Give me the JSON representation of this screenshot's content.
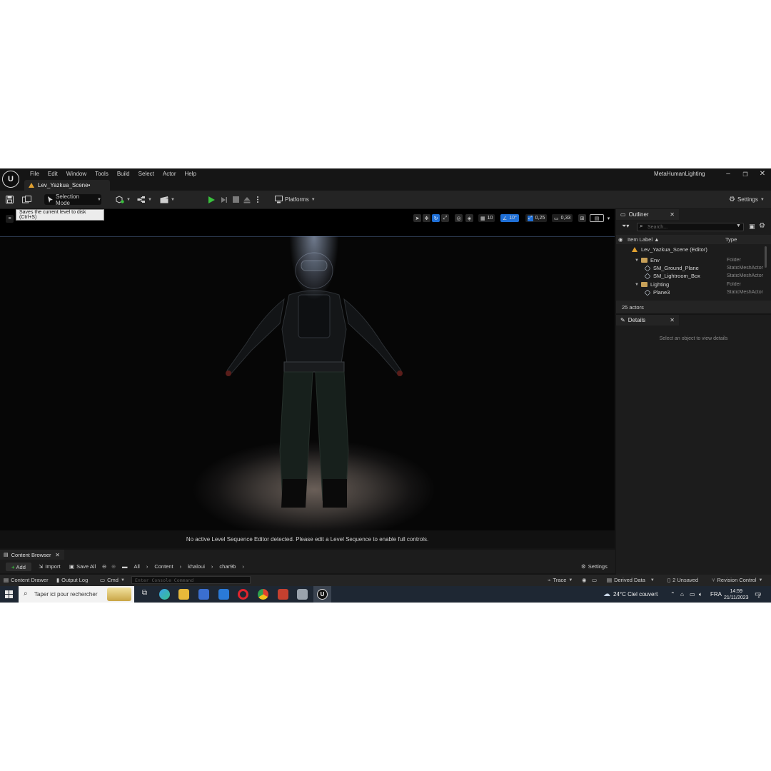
{
  "window": {
    "menu": [
      "File",
      "Edit",
      "Window",
      "Tools",
      "Build",
      "Select",
      "Actor",
      "Help"
    ],
    "level_tab": "Lev_Yazkua_Scene•",
    "project_name": "MetaHumanLighting",
    "controls": {
      "minimize": "–",
      "restore": "❐",
      "close": "✕"
    }
  },
  "toolbar": {
    "selection_mode": "Selection Mode",
    "platforms": "Platforms",
    "settings": "Settings"
  },
  "tooltip": "Saves the current level to disk (Ctrl+S)",
  "viewport": {
    "grid_snap": "10",
    "rotation_snap": "10°",
    "scale_snap": "0,25",
    "camera_speed": "0,33",
    "status_message": "No active Level Sequence Editor detected. Please edit a Level Sequence to enable full controls."
  },
  "outliner": {
    "tab": "Outliner",
    "search_placeholder": "Search...",
    "col_label": "Item Label ▲",
    "col_type": "Type",
    "rows": [
      {
        "label": "Lev_Yazkua_Scene (Editor)",
        "type": ""
      },
      {
        "label": "Env",
        "type": "Folder"
      },
      {
        "label": "SM_Ground_Plane",
        "type": "StaticMeshActor"
      },
      {
        "label": "SM_Lightroom_Box",
        "type": "StaticMeshActor"
      },
      {
        "label": "Lighting",
        "type": "Folder"
      },
      {
        "label": "Plane3",
        "type": "StaticMeshActor"
      }
    ],
    "actor_count": "25 actors"
  },
  "details": {
    "tab": "Details",
    "hint": "Select an object to view details"
  },
  "content_browser": {
    "tab": "Content Browser",
    "add": "Add",
    "import": "Import",
    "save_all": "Save All",
    "path": [
      "All",
      "Content",
      "khaloui",
      "char9b"
    ],
    "settings": "Settings"
  },
  "statusbar": {
    "content_drawer": "Content Drawer",
    "output_log": "Output Log",
    "cmd": "Cmd",
    "console_placeholder": "Enter Console Command",
    "trace": "Trace",
    "derived_data": "Derived Data",
    "unsaved": "2 Unsaved",
    "revision_control": "Revision Control"
  },
  "taskbar": {
    "search_placeholder": "Taper ici pour rechercher",
    "weather": "24°C  Ciel couvert",
    "language": "FRA",
    "time": "14:59",
    "date": "21/11/2023",
    "notification_count": "2"
  },
  "colors": {
    "play_green": "#39c13d",
    "active_blue": "#1f6fd6",
    "panel": "#1c1c1c",
    "toolbar": "#242424"
  }
}
